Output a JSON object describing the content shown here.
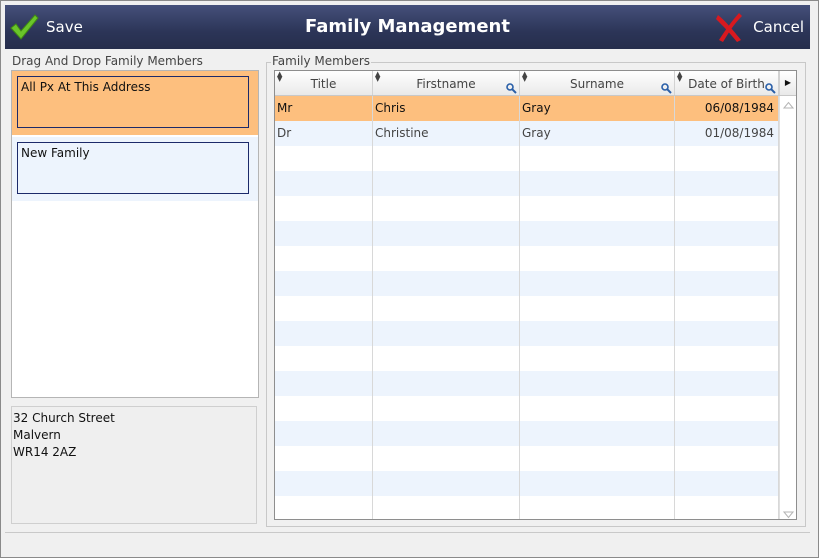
{
  "header": {
    "title": "Family Management",
    "save_label": "Save",
    "cancel_label": "Cancel"
  },
  "left": {
    "title": "Drag And Drop Family Members",
    "groups": [
      {
        "label": "All Px At This Address",
        "color": "#fdbf7e"
      },
      {
        "label": "New Family",
        "color": "#edf4fd"
      }
    ],
    "address": [
      "32 Church Street",
      "Malvern",
      "WR14 2AZ"
    ]
  },
  "members": {
    "title": "Family Members",
    "columns": [
      "Title",
      "Firstname",
      "Surname",
      "Date of Birth"
    ],
    "rows": [
      {
        "title": "Mr",
        "firstname": "Chris",
        "surname": "Gray",
        "dob": "06/08/1984",
        "selected": true
      },
      {
        "title": "Dr",
        "firstname": "Christine",
        "surname": "Gray",
        "dob": "01/08/1984",
        "selected": false
      }
    ],
    "selected_color": "#fdbf7e",
    "alt_row_color": "#edf4fd"
  },
  "icons": {
    "save": "checkmark-icon",
    "cancel": "cross-icon",
    "sort": "sort-icon",
    "filter": "search-icon",
    "column_menu": "arrow-right-icon",
    "scroll_up": "arrow-up-icon",
    "scroll_down": "arrow-down-icon"
  }
}
